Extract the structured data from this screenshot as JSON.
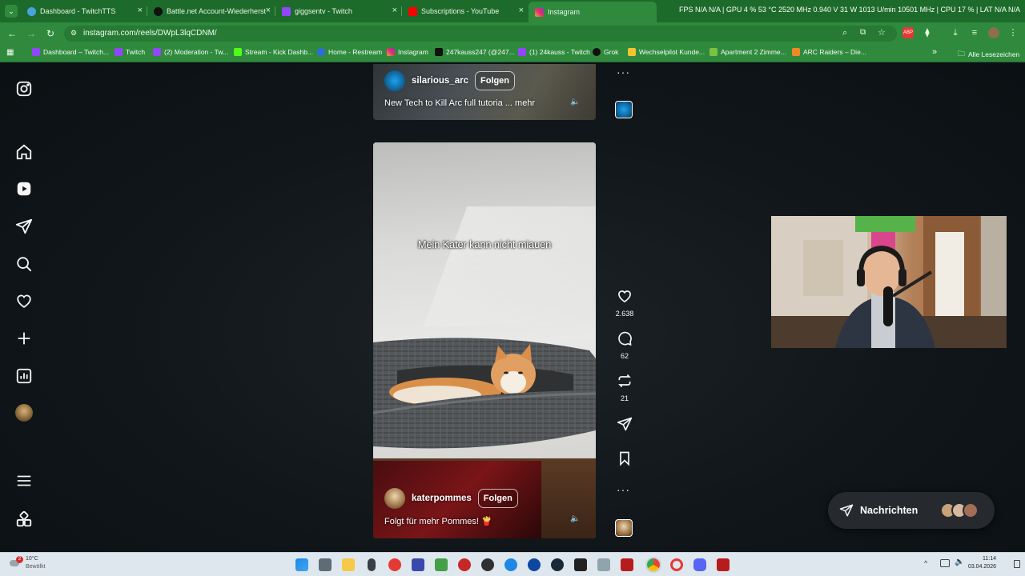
{
  "browser": {
    "tabs": [
      {
        "label": "Dashboard - TwitchTTS",
        "icon": "globe-icon"
      },
      {
        "label": "Battle.net Account-Wiederherst",
        "icon": "battlenet-icon"
      },
      {
        "label": "giggsentv - Twitch",
        "icon": "twitch-icon"
      },
      {
        "label": "Subscriptions - YouTube",
        "icon": "youtube-icon"
      },
      {
        "label": "Instagram",
        "icon": "instagram-icon",
        "active": true
      }
    ],
    "osd": "FPS N/A  N/A | GPU  4 %  53 °C  2520 MHz  0.940 V  31 W  1013 U/min  10501 MHz | CPU  17 % | LAT  N/A  N/A",
    "url": "instagram.com/reels/DWpL3lqCDNM/",
    "bookmarks": [
      {
        "label": "Dashboard – Twitch...",
        "color": "#9146ff"
      },
      {
        "label": "Twitch",
        "color": "#9146ff"
      },
      {
        "label": "(2) Moderation - Tw...",
        "color": "#9146ff"
      },
      {
        "label": "Stream - Kick Dashb...",
        "color": "#53fc18"
      },
      {
        "label": "Home - Restream",
        "color": "#2d6cdf"
      },
      {
        "label": "Instagram",
        "color": "#e1306c"
      },
      {
        "label": "247kauss247 (@247...",
        "color": "#111111"
      },
      {
        "label": "(1) 24kauss - Twitch",
        "color": "#9146ff"
      },
      {
        "label": "Grok",
        "color": "#111111"
      },
      {
        "label": "Wechselpilot Kunde...",
        "color": "#f4c430"
      },
      {
        "label": "Apartment 2 Zimme...",
        "color": "#7cc242"
      },
      {
        "label": "ARC Raiders – Die...",
        "color": "#f08a24"
      }
    ],
    "bookmarks_more": "»",
    "all_bookmarks": "Alle Lesezeichen"
  },
  "reels": {
    "top": {
      "username": "silarious_arc",
      "follow": "Folgen",
      "caption": "New Tech to Kill Arc full tutoria ... mehr"
    },
    "main": {
      "overlay_text": "Mein Kater kann nicht miauen",
      "username": "katerpommes",
      "follow": "Folgen",
      "caption": "Folgt für mehr Pommes! 🍟",
      "likes": "2.638",
      "comments": "62",
      "reposts": "21"
    }
  },
  "messages": {
    "label": "Nachrichten"
  },
  "taskbar": {
    "weather_temp": "10°C",
    "weather_desc": "Bewölkt",
    "notification_count": "2",
    "time": "11:14",
    "date": "03.04.2026"
  },
  "colors": {
    "browser_green": "#2f8a3d",
    "page_bg": "#10161a",
    "instagram_accent": "#e1306c"
  }
}
